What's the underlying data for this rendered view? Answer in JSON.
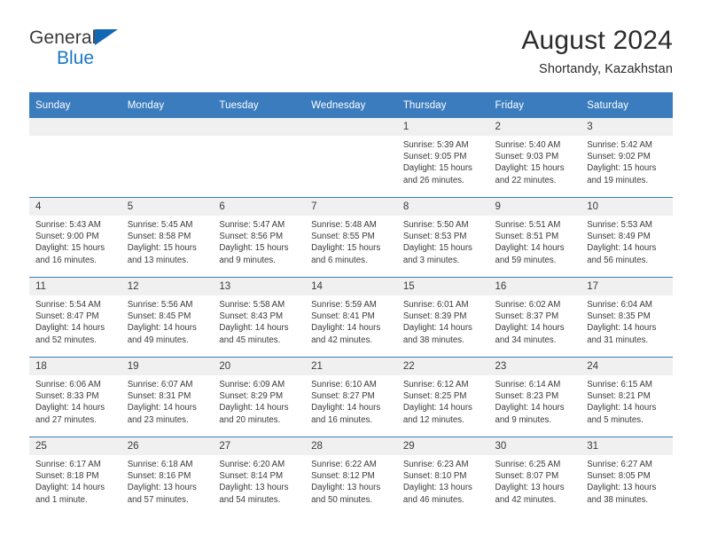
{
  "brand": {
    "line1": "General",
    "line2": "Blue",
    "triangle_color": "#1268b3",
    "blue_text_color": "#1878c8"
  },
  "header": {
    "title": "August 2024",
    "subtitle": "Shortandy, Kazakhstan"
  },
  "theme": {
    "header_row_bg": "#3b7cbe",
    "daynum_bg": "#f0f0f0",
    "text_color": "#3a3a3a"
  },
  "weekday_headers": [
    "Sunday",
    "Monday",
    "Tuesday",
    "Wednesday",
    "Thursday",
    "Friday",
    "Saturday"
  ],
  "labels": {
    "sunrise": "Sunrise:",
    "sunset": "Sunset:",
    "daylight": "Daylight:"
  },
  "weeks": [
    [
      {
        "day": "",
        "empty": true,
        "sunrise": "",
        "sunset": "",
        "daylight_a": "",
        "daylight_b": ""
      },
      {
        "day": "",
        "empty": true,
        "sunrise": "",
        "sunset": "",
        "daylight_a": "",
        "daylight_b": ""
      },
      {
        "day": "",
        "empty": true,
        "sunrise": "",
        "sunset": "",
        "daylight_a": "",
        "daylight_b": ""
      },
      {
        "day": "",
        "empty": true,
        "sunrise": "",
        "sunset": "",
        "daylight_a": "",
        "daylight_b": ""
      },
      {
        "day": "1",
        "empty": false,
        "sunrise": "Sunrise: 5:39 AM",
        "sunset": "Sunset: 9:05 PM",
        "daylight_a": "Daylight: 15 hours",
        "daylight_b": "and 26 minutes."
      },
      {
        "day": "2",
        "empty": false,
        "sunrise": "Sunrise: 5:40 AM",
        "sunset": "Sunset: 9:03 PM",
        "daylight_a": "Daylight: 15 hours",
        "daylight_b": "and 22 minutes."
      },
      {
        "day": "3",
        "empty": false,
        "sunrise": "Sunrise: 5:42 AM",
        "sunset": "Sunset: 9:02 PM",
        "daylight_a": "Daylight: 15 hours",
        "daylight_b": "and 19 minutes."
      }
    ],
    [
      {
        "day": "4",
        "empty": false,
        "sunrise": "Sunrise: 5:43 AM",
        "sunset": "Sunset: 9:00 PM",
        "daylight_a": "Daylight: 15 hours",
        "daylight_b": "and 16 minutes."
      },
      {
        "day": "5",
        "empty": false,
        "sunrise": "Sunrise: 5:45 AM",
        "sunset": "Sunset: 8:58 PM",
        "daylight_a": "Daylight: 15 hours",
        "daylight_b": "and 13 minutes."
      },
      {
        "day": "6",
        "empty": false,
        "sunrise": "Sunrise: 5:47 AM",
        "sunset": "Sunset: 8:56 PM",
        "daylight_a": "Daylight: 15 hours",
        "daylight_b": "and 9 minutes."
      },
      {
        "day": "7",
        "empty": false,
        "sunrise": "Sunrise: 5:48 AM",
        "sunset": "Sunset: 8:55 PM",
        "daylight_a": "Daylight: 15 hours",
        "daylight_b": "and 6 minutes."
      },
      {
        "day": "8",
        "empty": false,
        "sunrise": "Sunrise: 5:50 AM",
        "sunset": "Sunset: 8:53 PM",
        "daylight_a": "Daylight: 15 hours",
        "daylight_b": "and 3 minutes."
      },
      {
        "day": "9",
        "empty": false,
        "sunrise": "Sunrise: 5:51 AM",
        "sunset": "Sunset: 8:51 PM",
        "daylight_a": "Daylight: 14 hours",
        "daylight_b": "and 59 minutes."
      },
      {
        "day": "10",
        "empty": false,
        "sunrise": "Sunrise: 5:53 AM",
        "sunset": "Sunset: 8:49 PM",
        "daylight_a": "Daylight: 14 hours",
        "daylight_b": "and 56 minutes."
      }
    ],
    [
      {
        "day": "11",
        "empty": false,
        "sunrise": "Sunrise: 5:54 AM",
        "sunset": "Sunset: 8:47 PM",
        "daylight_a": "Daylight: 14 hours",
        "daylight_b": "and 52 minutes."
      },
      {
        "day": "12",
        "empty": false,
        "sunrise": "Sunrise: 5:56 AM",
        "sunset": "Sunset: 8:45 PM",
        "daylight_a": "Daylight: 14 hours",
        "daylight_b": "and 49 minutes."
      },
      {
        "day": "13",
        "empty": false,
        "sunrise": "Sunrise: 5:58 AM",
        "sunset": "Sunset: 8:43 PM",
        "daylight_a": "Daylight: 14 hours",
        "daylight_b": "and 45 minutes."
      },
      {
        "day": "14",
        "empty": false,
        "sunrise": "Sunrise: 5:59 AM",
        "sunset": "Sunset: 8:41 PM",
        "daylight_a": "Daylight: 14 hours",
        "daylight_b": "and 42 minutes."
      },
      {
        "day": "15",
        "empty": false,
        "sunrise": "Sunrise: 6:01 AM",
        "sunset": "Sunset: 8:39 PM",
        "daylight_a": "Daylight: 14 hours",
        "daylight_b": "and 38 minutes."
      },
      {
        "day": "16",
        "empty": false,
        "sunrise": "Sunrise: 6:02 AM",
        "sunset": "Sunset: 8:37 PM",
        "daylight_a": "Daylight: 14 hours",
        "daylight_b": "and 34 minutes."
      },
      {
        "day": "17",
        "empty": false,
        "sunrise": "Sunrise: 6:04 AM",
        "sunset": "Sunset: 8:35 PM",
        "daylight_a": "Daylight: 14 hours",
        "daylight_b": "and 31 minutes."
      }
    ],
    [
      {
        "day": "18",
        "empty": false,
        "sunrise": "Sunrise: 6:06 AM",
        "sunset": "Sunset: 8:33 PM",
        "daylight_a": "Daylight: 14 hours",
        "daylight_b": "and 27 minutes."
      },
      {
        "day": "19",
        "empty": false,
        "sunrise": "Sunrise: 6:07 AM",
        "sunset": "Sunset: 8:31 PM",
        "daylight_a": "Daylight: 14 hours",
        "daylight_b": "and 23 minutes."
      },
      {
        "day": "20",
        "empty": false,
        "sunrise": "Sunrise: 6:09 AM",
        "sunset": "Sunset: 8:29 PM",
        "daylight_a": "Daylight: 14 hours",
        "daylight_b": "and 20 minutes."
      },
      {
        "day": "21",
        "empty": false,
        "sunrise": "Sunrise: 6:10 AM",
        "sunset": "Sunset: 8:27 PM",
        "daylight_a": "Daylight: 14 hours",
        "daylight_b": "and 16 minutes."
      },
      {
        "day": "22",
        "empty": false,
        "sunrise": "Sunrise: 6:12 AM",
        "sunset": "Sunset: 8:25 PM",
        "daylight_a": "Daylight: 14 hours",
        "daylight_b": "and 12 minutes."
      },
      {
        "day": "23",
        "empty": false,
        "sunrise": "Sunrise: 6:14 AM",
        "sunset": "Sunset: 8:23 PM",
        "daylight_a": "Daylight: 14 hours",
        "daylight_b": "and 9 minutes."
      },
      {
        "day": "24",
        "empty": false,
        "sunrise": "Sunrise: 6:15 AM",
        "sunset": "Sunset: 8:21 PM",
        "daylight_a": "Daylight: 14 hours",
        "daylight_b": "and 5 minutes."
      }
    ],
    [
      {
        "day": "25",
        "empty": false,
        "sunrise": "Sunrise: 6:17 AM",
        "sunset": "Sunset: 8:18 PM",
        "daylight_a": "Daylight: 14 hours",
        "daylight_b": "and 1 minute."
      },
      {
        "day": "26",
        "empty": false,
        "sunrise": "Sunrise: 6:18 AM",
        "sunset": "Sunset: 8:16 PM",
        "daylight_a": "Daylight: 13 hours",
        "daylight_b": "and 57 minutes."
      },
      {
        "day": "27",
        "empty": false,
        "sunrise": "Sunrise: 6:20 AM",
        "sunset": "Sunset: 8:14 PM",
        "daylight_a": "Daylight: 13 hours",
        "daylight_b": "and 54 minutes."
      },
      {
        "day": "28",
        "empty": false,
        "sunrise": "Sunrise: 6:22 AM",
        "sunset": "Sunset: 8:12 PM",
        "daylight_a": "Daylight: 13 hours",
        "daylight_b": "and 50 minutes."
      },
      {
        "day": "29",
        "empty": false,
        "sunrise": "Sunrise: 6:23 AM",
        "sunset": "Sunset: 8:10 PM",
        "daylight_a": "Daylight: 13 hours",
        "daylight_b": "and 46 minutes."
      },
      {
        "day": "30",
        "empty": false,
        "sunrise": "Sunrise: 6:25 AM",
        "sunset": "Sunset: 8:07 PM",
        "daylight_a": "Daylight: 13 hours",
        "daylight_b": "and 42 minutes."
      },
      {
        "day": "31",
        "empty": false,
        "sunrise": "Sunrise: 6:27 AM",
        "sunset": "Sunset: 8:05 PM",
        "daylight_a": "Daylight: 13 hours",
        "daylight_b": "and 38 minutes."
      }
    ]
  ]
}
